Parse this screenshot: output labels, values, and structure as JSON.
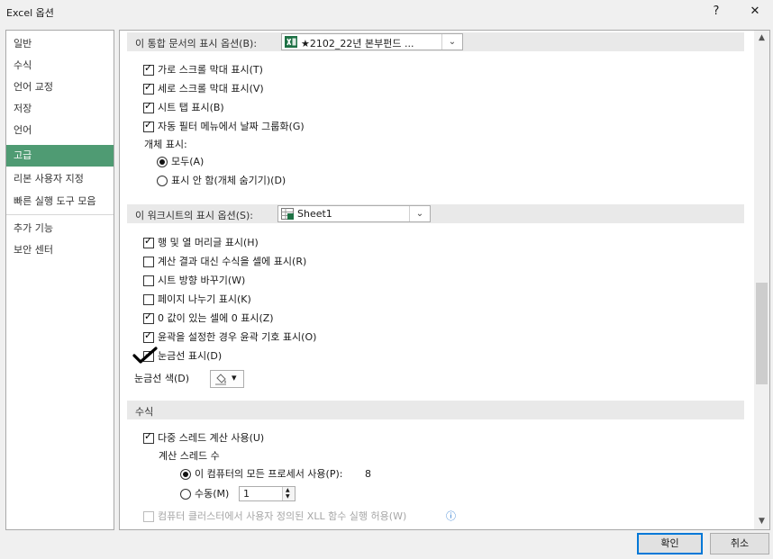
{
  "window": {
    "title": "Excel 옵션",
    "help_label": "?",
    "close_label": "✕"
  },
  "sidebar": {
    "items": [
      {
        "label": "일반",
        "selected": false
      },
      {
        "label": "수식",
        "selected": false
      },
      {
        "label": "언어 교정",
        "selected": false
      },
      {
        "label": "저장",
        "selected": false
      },
      {
        "label": "언어",
        "selected": false
      },
      {
        "label": "고급",
        "selected": true
      },
      {
        "label": "리본 사용자 지정",
        "selected": false
      },
      {
        "label": "빠른 실행 도구 모음",
        "selected": false
      },
      {
        "label": "추가 기능",
        "selected": false
      },
      {
        "label": "보안 센터",
        "selected": false
      }
    ]
  },
  "workbook_section": {
    "header_label": "이 통합 문서의 표시 옵션(B):",
    "workbook_select_value": "★2102_22년 본부펀드 ...",
    "options": [
      {
        "label": "가로 스크롤 막대 표시(T)",
        "checked": true
      },
      {
        "label": "세로 스크롤 막대 표시(V)",
        "checked": true
      },
      {
        "label": "시트 탭 표시(B)",
        "checked": true
      },
      {
        "label": "자동 필터 메뉴에서 날짜 그룹화(G)",
        "checked": true
      }
    ],
    "objects_label": "개체 표시:",
    "object_radios": [
      {
        "label": "모두(A)",
        "selected": true
      },
      {
        "label": "표시 안 함(개체 숨기기)(D)",
        "selected": false
      }
    ]
  },
  "worksheet_section": {
    "header_label": "이 워크시트의 표시 옵션(S):",
    "sheet_select_value": "Sheet1",
    "options": [
      {
        "label": "행 및 열 머리글 표시(H)",
        "checked": true
      },
      {
        "label": "계산 결과 대신 수식을 셀에 표시(R)",
        "checked": false
      },
      {
        "label": "시트 방향 바꾸기(W)",
        "checked": false
      },
      {
        "label": "페이지 나누기 표시(K)",
        "checked": false
      },
      {
        "label": "0 값이 있는 셀에 0 표시(Z)",
        "checked": true
      },
      {
        "label": "윤곽을 설정한 경우 윤곽 기호 표시(O)",
        "checked": true
      },
      {
        "label": "눈금선 표시(D)",
        "checked": true
      }
    ],
    "gridline_color_label": "눈금선 색(D)",
    "gridline_color_arrow": "▾"
  },
  "formula_section": {
    "header_label": "수식",
    "multithread_label": "다중 스레드 계산 사용(U)",
    "multithread_checked": true,
    "threads_label": "계산 스레드 수",
    "all_processors_label": "이 컴퓨터의 모든 프로세서 사용(P):",
    "all_processors_count": "8",
    "manual_label": "수동(M)",
    "manual_value": "1",
    "xll_label": "컴퓨터 클러스터에서 사용자 정의된 XLL 함수 실행 허용(W)",
    "info_icon_label": "ⓘ"
  },
  "scrollbar": {
    "up_arrow": "▲",
    "down_arrow": "▼"
  },
  "buttons": {
    "ok_label": "확인",
    "cancel_label": "취소"
  }
}
